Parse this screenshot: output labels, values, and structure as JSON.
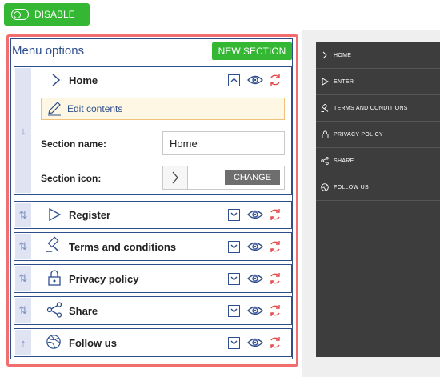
{
  "topbar": {
    "disable_label": "DISABLE"
  },
  "panel": {
    "title": "Menu options",
    "new_section_label": "NEW SECTION",
    "rows": [
      {
        "label": "Home",
        "handle": "↓",
        "icon": "chevron-right-icon"
      },
      {
        "label": "Register",
        "handle": "⇅",
        "icon": "play-icon"
      },
      {
        "label": "Terms and conditions",
        "handle": "⇅",
        "icon": "gavel-icon"
      },
      {
        "label": "Privacy policy",
        "handle": "⇅",
        "icon": "lock-icon"
      },
      {
        "label": "Share",
        "handle": "⇅",
        "icon": "share-icon"
      },
      {
        "label": "Follow us",
        "handle": "↑",
        "icon": "globe-icon"
      }
    ],
    "edit_contents_label": "Edit contents",
    "section_name_label": "Section name:",
    "section_name_value": "Home",
    "section_icon_label": "Section icon:",
    "change_label": "CHANGE"
  },
  "preview_menu": {
    "items": [
      {
        "label": "HOME",
        "icon": "chevron-right-icon"
      },
      {
        "label": "ENTER",
        "icon": "play-icon"
      },
      {
        "label": "TERMS AND CONDITIONS",
        "icon": "gavel-icon"
      },
      {
        "label": "PRIVACY POLICY",
        "icon": "lock-icon"
      },
      {
        "label": "SHARE",
        "icon": "share-icon"
      },
      {
        "label": "FOLLOW US",
        "icon": "globe-icon"
      }
    ]
  },
  "colors": {
    "green": "#34b834",
    "navy": "#2e4f8e",
    "red_frame": "#f06e6e",
    "dark_menu": "#3d3d3d",
    "edit_bg": "#fef7e3"
  }
}
